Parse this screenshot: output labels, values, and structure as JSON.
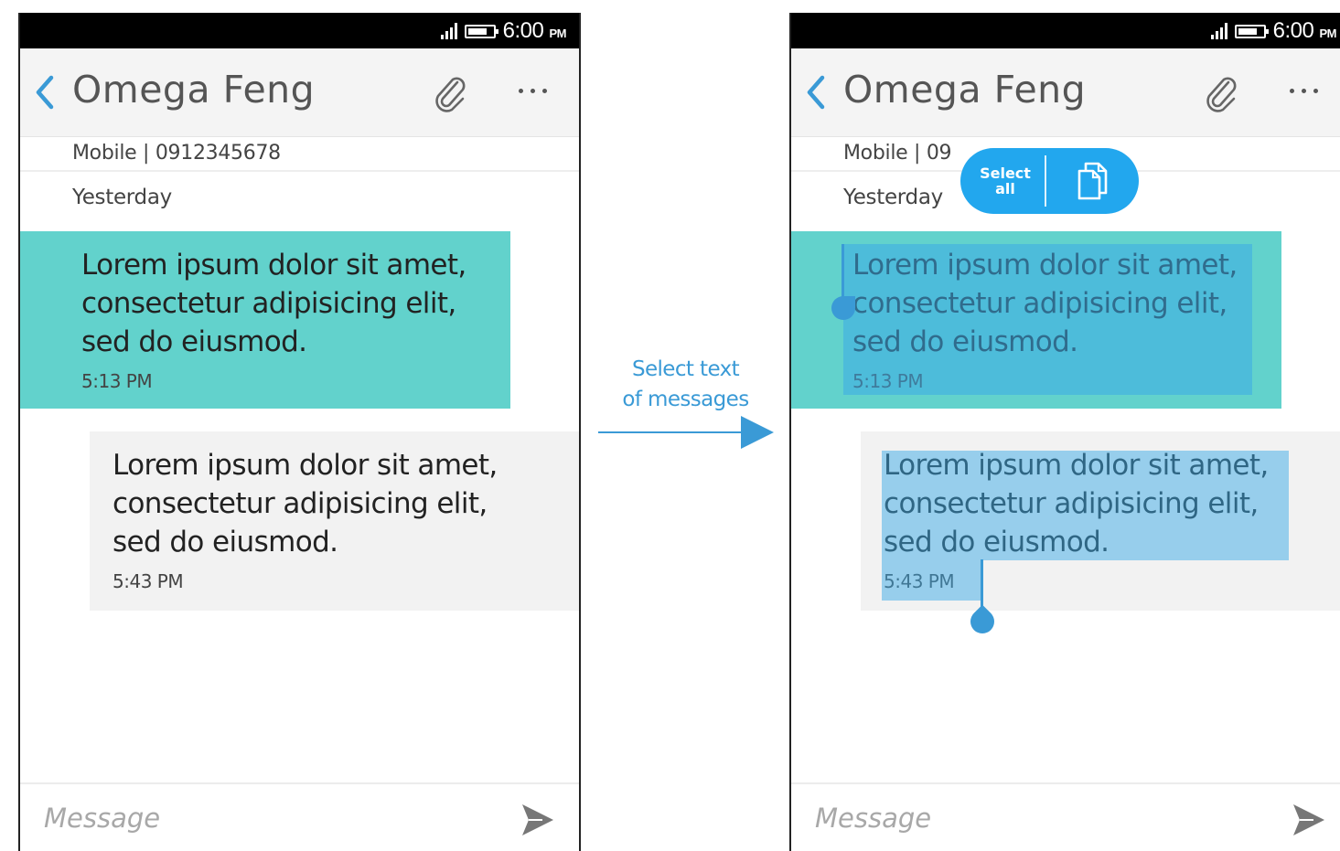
{
  "status_bar": {
    "time": "6:00",
    "period": "PM"
  },
  "conversation": {
    "contact_name": "Omega Feng",
    "contact_info": "Mobile | 0912345678",
    "contact_info_partial": "Mobile | 09",
    "date_label": "Yesterday",
    "messages": [
      {
        "direction": "outgoing",
        "text": "Lorem ipsum dolor sit amet,\nconsectetur adipisicing elit,\nsed do eiusmod.",
        "time": "5:13 PM"
      },
      {
        "direction": "incoming",
        "text": "Lorem ipsum dolor sit amet,\nconsectetur adipisicing elit,\nsed do eiusmod.",
        "time": "5:43 PM"
      }
    ],
    "composer_placeholder": "Message"
  },
  "transition": {
    "label": "Select text\nof messages"
  },
  "selection_popup": {
    "select_all_label": "Select\nall",
    "copy_icon": "copy-icon"
  },
  "icons": [
    "back-icon",
    "attach-icon",
    "more-icon",
    "send-icon",
    "signal-icon",
    "battery-icon",
    "copy-icon"
  ],
  "colors": {
    "outgoing_bubble": "#62d2cc",
    "incoming_bubble": "#f2f2f2",
    "accent": "#3a9ad6",
    "popup": "#22a7ee",
    "status_bar": "#000000"
  }
}
